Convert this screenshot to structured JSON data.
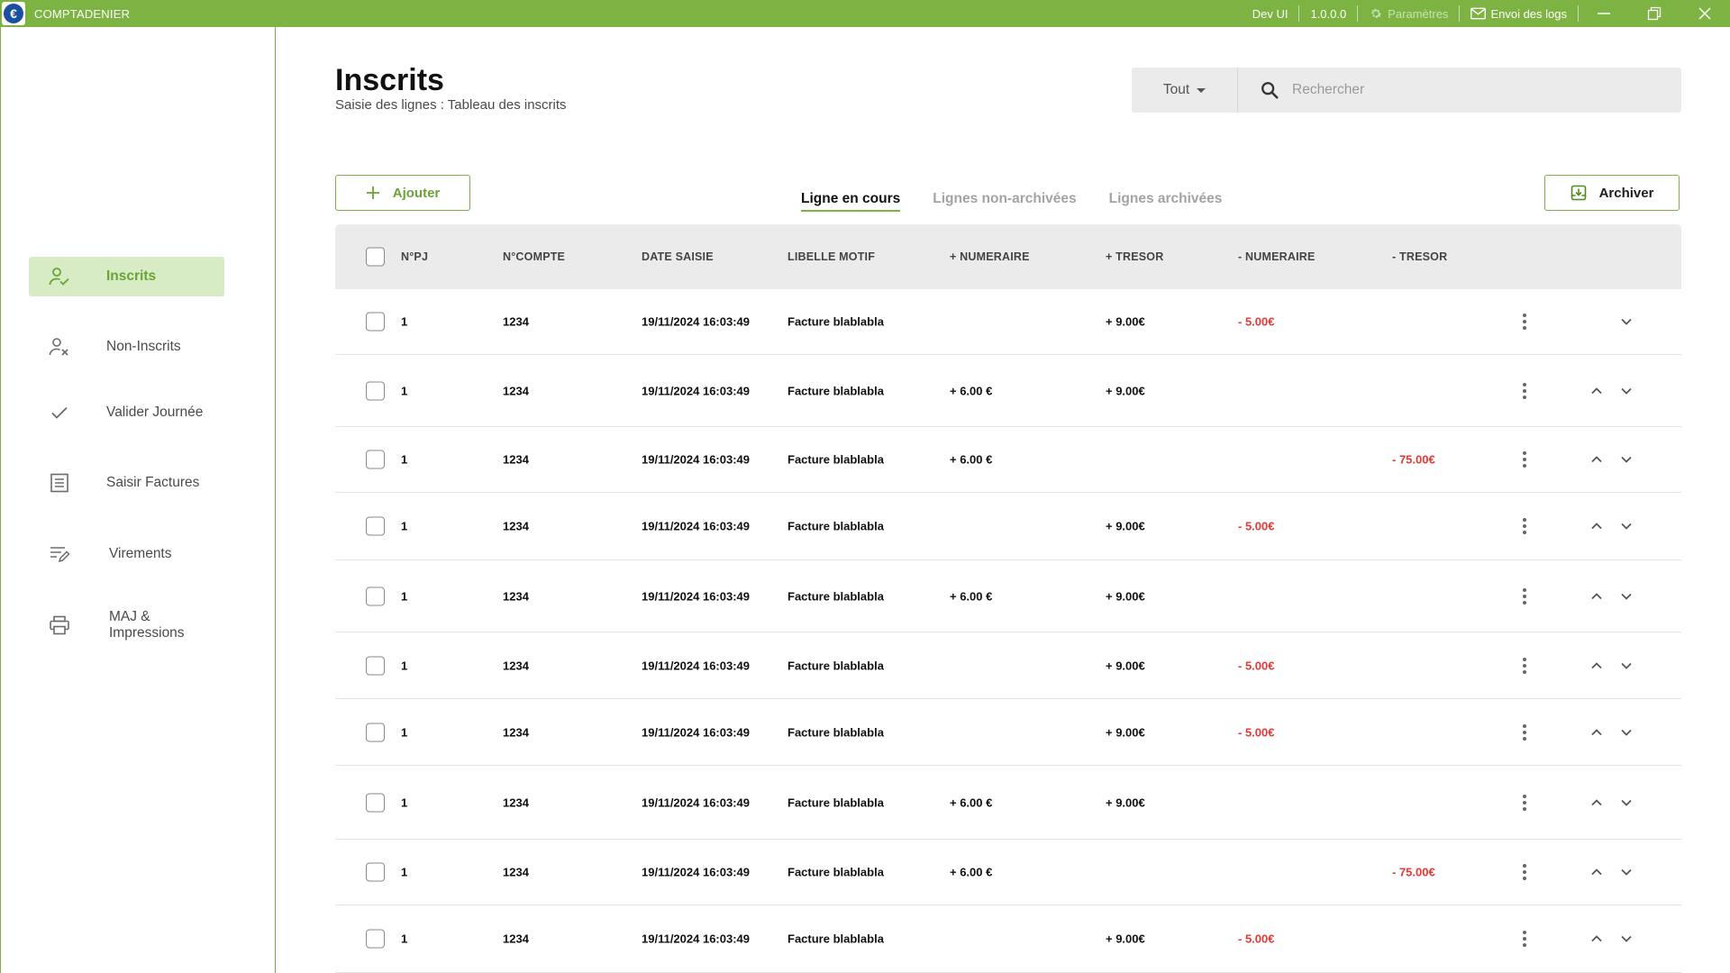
{
  "titlebar": {
    "app_name": "COMPTADENIER",
    "logo_glyph": "€",
    "env": "Dev UI",
    "version": "1.0.0.0",
    "settings_label": "Paramètres",
    "logs_label": "Envoi des logs"
  },
  "sidebar": {
    "items": [
      {
        "label": "Inscrits",
        "icon": "user-check-icon",
        "active": true
      },
      {
        "label": "Non-Inscrits",
        "icon": "user-x-icon"
      },
      {
        "label": "Valider Journée",
        "icon": "check-icon"
      },
      {
        "label": "Saisir Factures",
        "icon": "document-icon"
      },
      {
        "label": "Virements",
        "icon": "edit-note-icon"
      },
      {
        "label": "MAJ & Impressions",
        "icon": "printer-icon"
      }
    ]
  },
  "header": {
    "title": "Inscrits",
    "subtitle": "Saisie des lignes : Tableau des inscrits"
  },
  "search": {
    "filter_value": "Tout",
    "placeholder": "Rechercher"
  },
  "toolbar": {
    "add_label": "Ajouter",
    "archive_label": "Archiver"
  },
  "tabs": [
    {
      "label": "Ligne en cours",
      "active": true
    },
    {
      "label": "Lignes non-archivées"
    },
    {
      "label": "Lignes archivées"
    }
  ],
  "table": {
    "columns": [
      "N°PJ",
      "N°COMPTE",
      "DATE SAISIE",
      "LIBELLE MOTIF",
      "+ NUMERAIRE",
      "+ TRESOR",
      "- NUMERAIRE",
      "- TRESOR"
    ],
    "rows": [
      {
        "pj": "1",
        "compte": "1234",
        "date": "19/11/2024 16:03:49",
        "libelle": "Facture blablabla",
        "plus_num": "",
        "plus_tre": "+ 9.00€",
        "moins_num": "- 5.00€",
        "moins_tre": ""
      },
      {
        "pj": "1",
        "compte": "1234",
        "date": "19/11/2024 16:03:49",
        "libelle": "Facture blablabla",
        "plus_num": "+ 6.00 €",
        "plus_tre": "+ 9.00€",
        "moins_num": "",
        "moins_tre": ""
      },
      {
        "pj": "1",
        "compte": "1234",
        "date": "19/11/2024 16:03:49",
        "libelle": "Facture blablabla",
        "plus_num": "+ 6.00 €",
        "plus_tre": "",
        "moins_num": "",
        "moins_tre": "-  75.00€"
      },
      {
        "pj": "1",
        "compte": "1234",
        "date": "19/11/2024 16:03:49",
        "libelle": "Facture blablabla",
        "plus_num": "",
        "plus_tre": "+ 9.00€",
        "moins_num": "- 5.00€",
        "moins_tre": ""
      },
      {
        "pj": "1",
        "compte": "1234",
        "date": "19/11/2024 16:03:49",
        "libelle": "Facture blablabla",
        "plus_num": "+ 6.00 €",
        "plus_tre": "+ 9.00€",
        "moins_num": "",
        "moins_tre": ""
      },
      {
        "pj": "1",
        "compte": "1234",
        "date": "19/11/2024 16:03:49",
        "libelle": "Facture blablabla",
        "plus_num": "",
        "plus_tre": "+ 9.00€",
        "moins_num": "- 5.00€",
        "moins_tre": ""
      },
      {
        "pj": "1",
        "compte": "1234",
        "date": "19/11/2024 16:03:49",
        "libelle": "Facture blablabla",
        "plus_num": "",
        "plus_tre": "+ 9.00€",
        "moins_num": "- 5.00€",
        "moins_tre": ""
      },
      {
        "pj": "1",
        "compte": "1234",
        "date": "19/11/2024 16:03:49",
        "libelle": "Facture blablabla",
        "plus_num": "+ 6.00 €",
        "plus_tre": "+ 9.00€",
        "moins_num": "",
        "moins_tre": ""
      },
      {
        "pj": "1",
        "compte": "1234",
        "date": "19/11/2024 16:03:49",
        "libelle": "Facture blablabla",
        "plus_num": "+ 6.00 €",
        "plus_tre": "",
        "moins_num": "",
        "moins_tre": "-  75.00€"
      },
      {
        "pj": "1",
        "compte": "1234",
        "date": "19/11/2024 16:03:49",
        "libelle": "Facture blablabla",
        "plus_num": "",
        "plus_tre": "+ 9.00€",
        "moins_num": "- 5.00€",
        "moins_tre": ""
      }
    ]
  },
  "colors": {
    "accent": "#7cb342",
    "accent_light": "#d7ebc4",
    "negative": "#e53935"
  }
}
